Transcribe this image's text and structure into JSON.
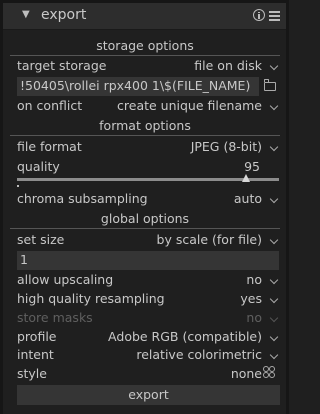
{
  "header": {
    "title": "export",
    "chevron": "▼"
  },
  "sections": {
    "storage": "storage options",
    "format": "format options",
    "global": "global options"
  },
  "storage": {
    "target_label": "target storage",
    "target_value": "file on disk",
    "path": "!50405\\rollei rpx400 1\\$(FILE_NAME)",
    "conflict_label": "on conflict",
    "conflict_value": "create unique filename"
  },
  "format": {
    "file_format_label": "file format",
    "file_format_value": "JPEG (8-bit)",
    "quality_label": "quality",
    "quality_value": "95",
    "chroma_label": "chroma subsampling",
    "chroma_value": "auto"
  },
  "global": {
    "set_size_label": "set size",
    "set_size_value": "by scale (for file)",
    "scale_value": "1",
    "upscaling_label": "allow upscaling",
    "upscaling_value": "no",
    "hq_label": "high quality resampling",
    "hq_value": "yes",
    "masks_label": "store masks",
    "masks_value": "no",
    "profile_label": "profile",
    "profile_value": "Adobe RGB (compatible)",
    "intent_label": "intent",
    "intent_value": "relative colorimetric",
    "style_label": "style",
    "style_value": "none"
  },
  "export_button": "export"
}
